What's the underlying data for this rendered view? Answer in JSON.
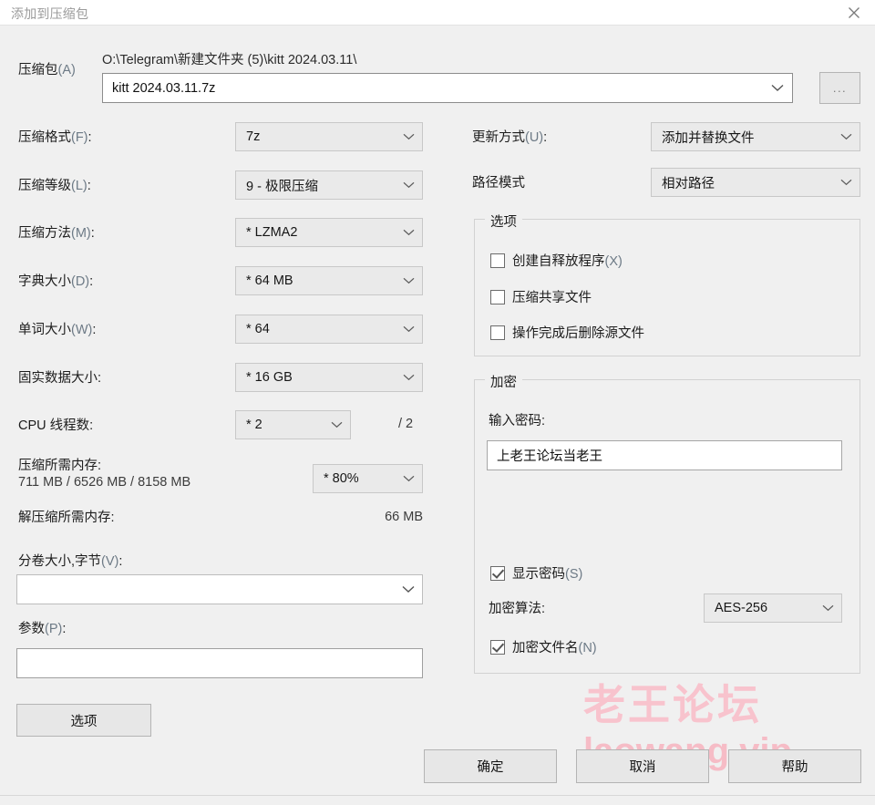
{
  "window": {
    "title": "添加到压缩包",
    "close_icon": "close-icon"
  },
  "archive": {
    "label": "压缩包",
    "mnemonic": "(A)",
    "path": "O:\\Telegram\\新建文件夹 (5)\\kitt 2024.03.11\\",
    "filename": "kitt 2024.03.11.7z",
    "browse_label": "..."
  },
  "left": {
    "format": {
      "label": "压缩格式",
      "mnemonic": "(F)",
      "value": "7z"
    },
    "level": {
      "label": "压缩等级",
      "mnemonic": "(L)",
      "value": "9 - 极限压缩"
    },
    "method": {
      "label": "压缩方法",
      "mnemonic": "(M)",
      "value": "*  LZMA2"
    },
    "dictionary": {
      "label": "字典大小",
      "mnemonic": "(D)",
      "value": "*  64 MB"
    },
    "word": {
      "label": "单词大小",
      "mnemonic": "(W)",
      "value": "*  64"
    },
    "solid": {
      "label": "固实数据大小",
      "mnemonic": "",
      "value": "*  16 GB"
    },
    "threads": {
      "label": "CPU 线程数",
      "mnemonic": "",
      "value": "*  2",
      "total": "/ 2"
    },
    "mem_compress": {
      "label": "压缩所需内存",
      "values": "711 MB / 6526 MB / 8158 MB",
      "percent": "*  80%"
    },
    "mem_decompress": {
      "label": "解压缩所需内存",
      "value": "66 MB"
    },
    "split": {
      "label": "分卷大小,字节",
      "mnemonic": "(V)",
      "value": ""
    },
    "params": {
      "label": "参数",
      "mnemonic": "(P)",
      "value": ""
    },
    "options_button": "选项"
  },
  "right": {
    "update_mode": {
      "label": "更新方式",
      "mnemonic": "(U)",
      "value": "添加并替换文件"
    },
    "path_mode": {
      "label": "路径模式",
      "mnemonic": "",
      "value": "相对路径"
    },
    "options_group": {
      "title": "选项",
      "items": [
        {
          "label": "创建自释放程序",
          "mnemonic": "(X)",
          "checked": false
        },
        {
          "label": "压缩共享文件",
          "mnemonic": "",
          "checked": false
        },
        {
          "label": "操作完成后删除源文件",
          "mnemonic": "",
          "checked": false
        }
      ]
    },
    "encryption_group": {
      "title": "加密",
      "password_label": "输入密码:",
      "password_value": "上老王论坛当老王",
      "show_password": {
        "label": "显示密码",
        "mnemonic": "(S)",
        "checked": true
      },
      "algorithm_label": "加密算法:",
      "algorithm_value": "AES-256",
      "encrypt_filenames": {
        "label": "加密文件名",
        "mnemonic": "(N)",
        "checked": true
      }
    }
  },
  "footer": {
    "ok": "确定",
    "cancel": "取消",
    "help": "帮助"
  },
  "watermark": {
    "cn": "老王论坛",
    "en": "laowang.vip",
    "color": "#f8c3cd"
  }
}
